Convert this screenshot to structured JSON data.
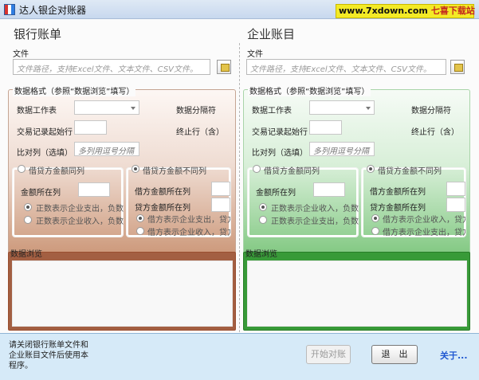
{
  "window": {
    "title": "达人银企对账器"
  },
  "watermark": {
    "domain": "www.7xdown.com",
    "site_name": "七喜下载站"
  },
  "bank": {
    "section_title": "银行账单",
    "file_label": "文件",
    "file_placeholder": "文件路径，支持Excel文件、文本文件、CSV文件。",
    "format_title": "数据格式（参照“数据浏览”填写）",
    "worksheet_label": "数据工作表",
    "separator_label": "数据分隔符",
    "start_row_label": "交易记录起始行",
    "end_row_label": "终止行（含）",
    "compare_col_label": "比对列（选填）",
    "compare_col_placeholder": "多列用逗号分隔",
    "same_col_label": "借贷方金额同列",
    "diff_col_label": "借贷方金额不同列",
    "amount_col_label": "金额所在列",
    "same_positive_label": "正数表示企业支出，负数",
    "same_negative_label": "正数表示企业收入，负数",
    "debit_col_label": "借方金额所在列",
    "credit_col_label": "贷方金额所在列",
    "debit_expense_label": "借方表示企业支出，贷方",
    "debit_income_label": "借方表示企业收入，贷方",
    "browse_title": "数据浏览"
  },
  "corp": {
    "section_title": "企业账目",
    "file_label": "文件",
    "file_placeholder": "文件路径，支持Excel文件、文本文件、CSV文件。",
    "format_title": "数据格式（参照“数据浏览”填写）",
    "worksheet_label": "数据工作表",
    "separator_label": "数据分隔符",
    "start_row_label": "交易记录起始行",
    "end_row_label": "终止行（含）",
    "compare_col_label": "比对列（选填）",
    "compare_col_placeholder": "多列用逗号分隔",
    "same_col_label": "借贷方金额同列",
    "diff_col_label": "借贷方金额不同列",
    "amount_col_label": "金额所在列",
    "same_positive_label": "正数表示企业收入，负数",
    "same_negative_label": "正数表示企业支出，负数",
    "debit_col_label": "借方金额所在列",
    "credit_col_label": "贷方金额所在列",
    "debit_expense_label": "借方表示企业收入，贷方",
    "debit_income_label": "借方表示企业支出，贷方",
    "browse_title": "数据浏览"
  },
  "footer": {
    "note": "请关闭银行账单文件和企业账目文件后使用本程序。",
    "start_label": "开始对账",
    "exit_label": "退　出",
    "about_label": "关于..."
  }
}
